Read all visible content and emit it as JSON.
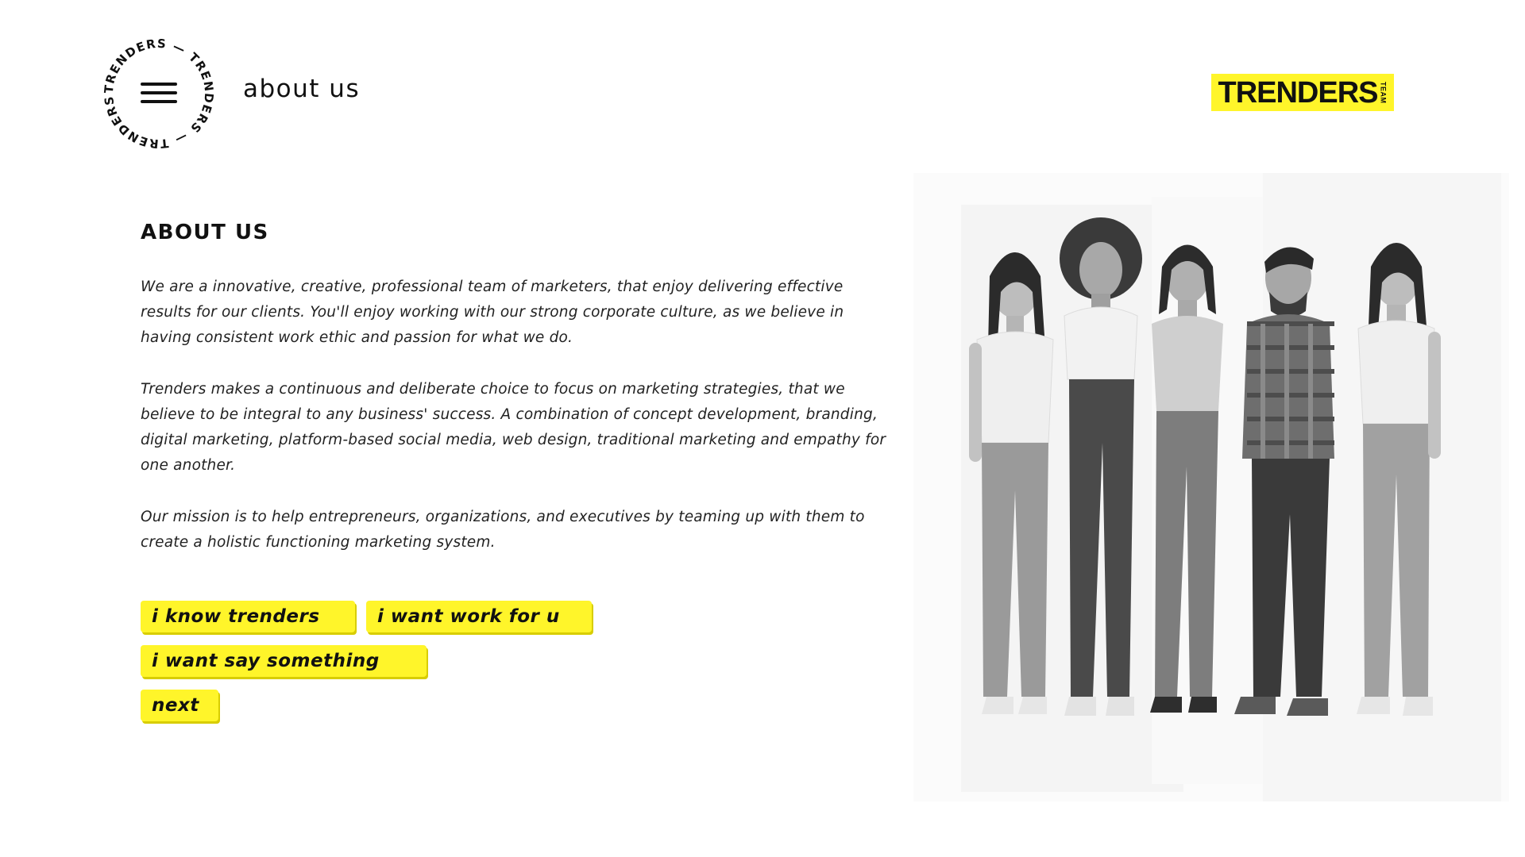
{
  "header": {
    "badge_text": "TRENDERS — TRENDERS — TRENDERS — ",
    "page_label": "about us",
    "logo_word": "TRENDERS",
    "logo_team": "TEAM"
  },
  "content": {
    "heading": "ABOUT US",
    "paragraphs": [
      "We are a innovative, creative, professional team of marketers, that enjoy delivering effective results for our clients. You'll enjoy working with our strong corporate culture, as we believe in having consistent work ethic and passion for what we do.",
      "Trenders makes a continuous and deliberate choice to focus on marketing strategies, that we believe to be integral to any business' success. A combination of concept development, branding, digital marketing, platform-based social media, web design, traditional marketing and empathy for one another.",
      "Our mission is to help entrepreneurs, organizations, and executives by teaming up with them to create a holistic functioning marketing system."
    ],
    "buttons": [
      "i know trenders",
      "i want work for u",
      "i want say something",
      "next"
    ]
  },
  "photo": {
    "alt": "team-photo"
  },
  "colors": {
    "accent": "#fff52a",
    "text": "#111111",
    "background": "#ffffff"
  },
  "icons": [
    "hamburger-menu-icon"
  ]
}
